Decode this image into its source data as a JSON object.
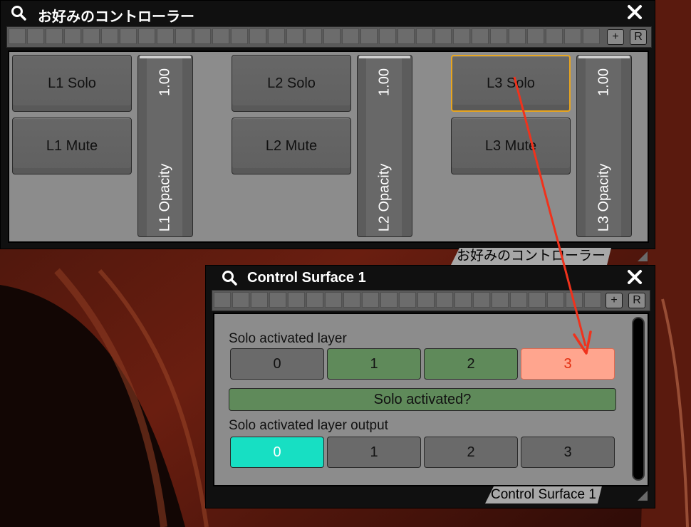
{
  "window1": {
    "title": "お好みのコントローラー",
    "footer": "お好みのコントローラー",
    "plus_label": "+",
    "reset_label": "R",
    "layers": [
      {
        "solo": "L1 Solo",
        "mute": "L1 Mute",
        "opacity_label": "L1 Opacity",
        "opacity_value": "1.00"
      },
      {
        "solo": "L2 Solo",
        "mute": "L2 Mute",
        "opacity_label": "L2 Opacity",
        "opacity_value": "1.00"
      },
      {
        "solo": "L3 Solo",
        "mute": "L3 Mute",
        "opacity_label": "L3 Opacity",
        "opacity_value": "1.00"
      }
    ]
  },
  "window2": {
    "title": "Control Surface 1",
    "footer": "Control Surface 1",
    "plus_label": "+",
    "reset_label": "R",
    "solo_layer_label": "Solo activated layer",
    "solo_layer_buttons": [
      "0",
      "1",
      "2",
      "3"
    ],
    "solo_activated_label": "Solo activated?",
    "output_label": "Solo activated layer output",
    "output_buttons": [
      "0",
      "1",
      "2",
      "3"
    ]
  },
  "colors": {
    "focus": "#e8a51e",
    "green": "#5f8a5a",
    "salmon": "#ffa58e",
    "salmon_text": "#e32e10",
    "cyan": "#17dfc3",
    "arrow": "#f0321c"
  }
}
